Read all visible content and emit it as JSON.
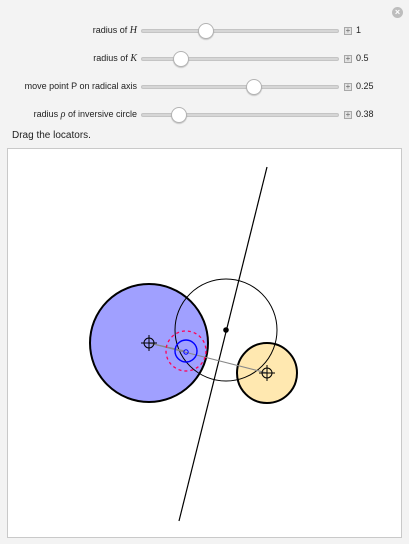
{
  "controls": [
    {
      "label": "radius of ",
      "var": "H",
      "value": "1",
      "fraction": 0.33
    },
    {
      "label": "radius of ",
      "var": "K",
      "value": "0.5",
      "fraction": 0.2
    },
    {
      "label": "move point P on radical axis",
      "var": "",
      "value": "0.25",
      "fraction": 0.57
    },
    {
      "label": "radius ",
      "var": "ρ",
      "label_suffix": " of inversive circle",
      "value": "0.38",
      "fraction": 0.19
    }
  ],
  "instruction": "Drag the locators.",
  "colors": {
    "circle_h_fill": "#a0a0ff",
    "circle_k_fill": "#ffe8b0",
    "inverse_circle": "#ff0055",
    "small_circle": "#0000ff"
  },
  "icons": {
    "close": "close-icon",
    "plus": "plus-icon",
    "locator": "crosshair-icon"
  }
}
